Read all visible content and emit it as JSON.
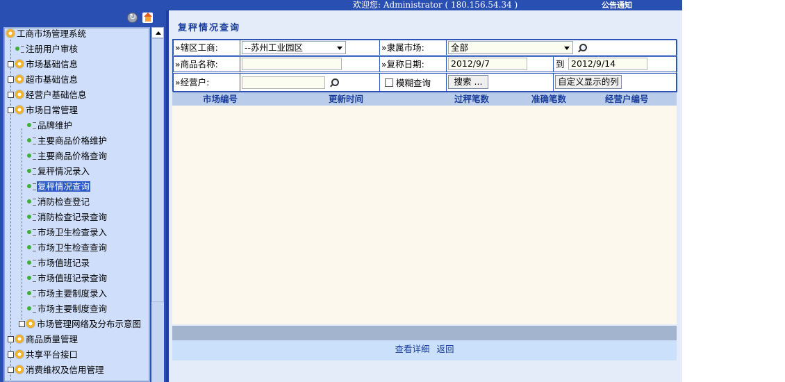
{
  "topbar": {
    "welcome": "欢迎您: Administrator ( 180.156.54.34 )",
    "notice": "公告通知"
  },
  "tree": {
    "root": "工商市场管理系统",
    "nodes": [
      {
        "label": "注册用户审核"
      },
      {
        "label": "市场基础信息"
      },
      {
        "label": "超市基础信息"
      },
      {
        "label": "经营户基础信息"
      },
      {
        "label": "市场日常管理"
      },
      {
        "label": "品牌维护"
      },
      {
        "label": "主要商品价格维护"
      },
      {
        "label": "主要商品价格查询"
      },
      {
        "label": "复秤情况录入"
      },
      {
        "label": "复秤情况查询"
      },
      {
        "label": "消防检查登记"
      },
      {
        "label": "消防检查记录查询"
      },
      {
        "label": "市场卫生检查录入"
      },
      {
        "label": "市场卫生检查查询"
      },
      {
        "label": "市场值班记录"
      },
      {
        "label": "市场值班记录查询"
      },
      {
        "label": "市场主要制度录入"
      },
      {
        "label": "市场主要制度查询"
      },
      {
        "label": "市场管理网络及分布示意图"
      },
      {
        "label": "商品质量管理"
      },
      {
        "label": "共享平台接口"
      },
      {
        "label": "消费维权及信用管理"
      }
    ]
  },
  "main": {
    "title": "复秤情况查询",
    "query": {
      "district_label": "»辖区工商:",
      "district_value": "--苏州工业园区",
      "market_label": "»隶属市场:",
      "market_value": "全部",
      "product_label": "»商品名称:",
      "product_value": "",
      "date_label": "»复称日期:",
      "date_from": "2012/9/7",
      "date_to_label": "到",
      "date_to": "2012/9/14",
      "vendor_label": "»经营户:",
      "vendor_value": "",
      "fuzzy_label": "模糊查询",
      "search_button": "搜索 ...",
      "custom_columns_button": "自定义显示的列"
    },
    "grid": {
      "columns": [
        "市场编号",
        "更新时间",
        "过秤笔数",
        "准确笔数",
        "经营户编号"
      ],
      "rows": []
    },
    "links": {
      "detail": "查看详细",
      "back": "返回"
    }
  }
}
